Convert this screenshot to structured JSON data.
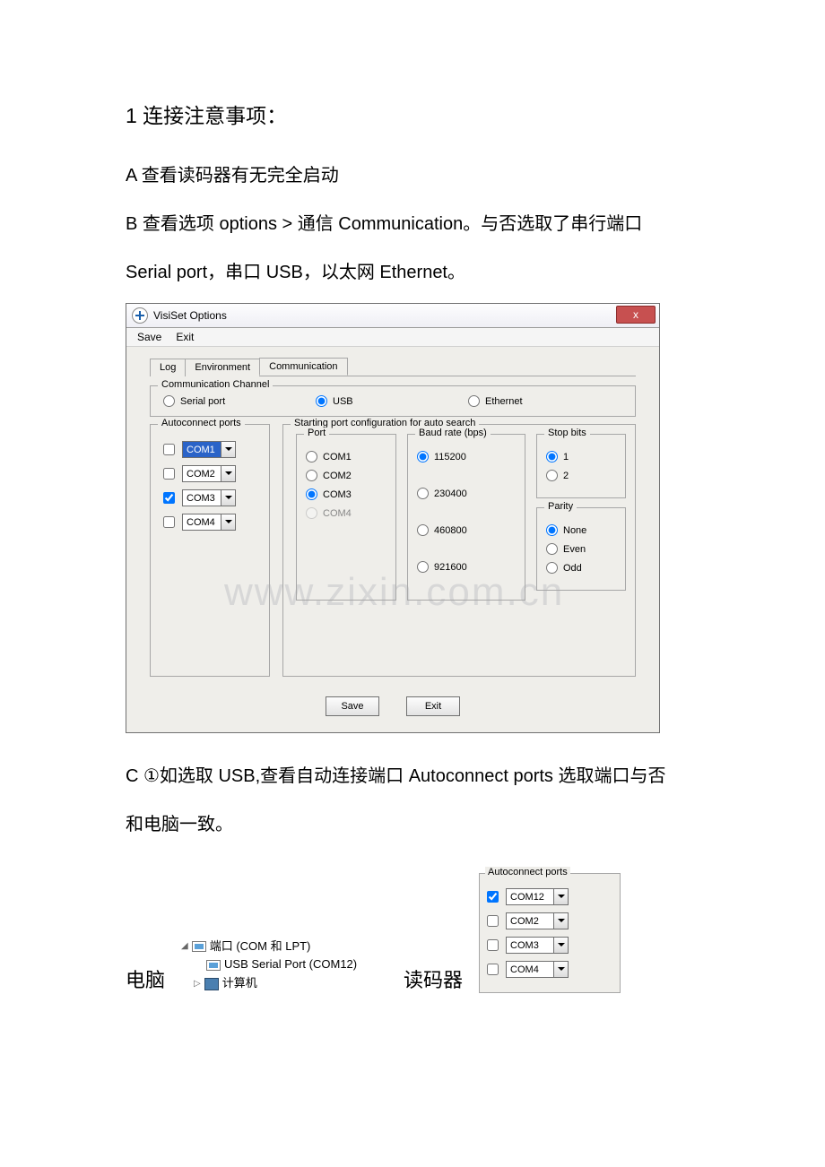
{
  "headings": {
    "h1": "1  连接注意事项：",
    "pA": "A  查看读码器有无完全启动",
    "pB1": "B  查看选项 options   >   通信 Communication。与否选取了串行端口",
    "pB2": "Serial port，串口 USB，以太网 Ethernet。",
    "pC1": "C  ①如选取 USB,查看自动连接端口 Autoconnect ports 选取端口与否",
    "pC2": "和电脑一致。"
  },
  "dialog": {
    "title": "VisiSet Options",
    "close": "x",
    "menu": {
      "save": "Save",
      "exit": "Exit"
    },
    "tabs": {
      "log": "Log",
      "env": "Environment",
      "comm": "Communication"
    },
    "grpChannel": "Communication Channel",
    "channel": {
      "serial": "Serial port",
      "usb": "USB",
      "eth": "Ethernet"
    },
    "grpAuto": "Autoconnect ports",
    "autoports": [
      {
        "chk": false,
        "val": "COM1",
        "sel": true
      },
      {
        "chk": false,
        "val": "COM2",
        "sel": false
      },
      {
        "chk": true,
        "val": "COM3",
        "sel": false
      },
      {
        "chk": false,
        "val": "COM4",
        "sel": false
      }
    ],
    "grpStart": "Starting port configuration for auto search",
    "grpPort": "Port",
    "ports": {
      "c1": "COM1",
      "c2": "COM2",
      "c3": "COM3",
      "c4": "COM4"
    },
    "grpBaud": "Baud rate (bps)",
    "baud": {
      "b1": "115200",
      "b2": "230400",
      "b3": "460800",
      "b4": "921600"
    },
    "grpStop": "Stop bits",
    "stop": {
      "s1": "1",
      "s2": "2"
    },
    "grpParity": "Parity",
    "parity": {
      "p1": "None",
      "p2": "Even",
      "p3": "Odd"
    },
    "btnSave": "Save",
    "btnExit": "Exit"
  },
  "watermark": "www.zixin.com.cn",
  "tree": {
    "ports": "端口 (COM 和 LPT)",
    "usb": "USB Serial Port (COM12)",
    "pc": "计算机"
  },
  "labels": {
    "pc": "电脑",
    "reader": "读码器"
  },
  "auto2": {
    "legend": "Autoconnect ports",
    "items": [
      {
        "chk": true,
        "val": "COM12"
      },
      {
        "chk": false,
        "val": "COM2"
      },
      {
        "chk": false,
        "val": "COM3"
      },
      {
        "chk": false,
        "val": "COM4"
      }
    ]
  }
}
